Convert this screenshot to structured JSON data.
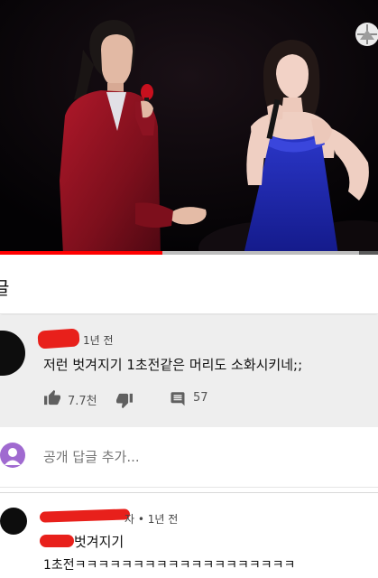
{
  "video": {
    "progress_fraction": 0.43,
    "buffered_fraction": 0.95,
    "colors": {
      "progress": "#ff0000",
      "buffer": "#bdbdbd",
      "track": "#5a5a5a"
    }
  },
  "comments": {
    "header_title": "글"
  },
  "comment1": {
    "time": "1년 전",
    "text": "저런 벗겨지기 1초전같은 머리도 소화시키네;;",
    "likes": "7.7천",
    "replies": "57"
  },
  "reply_box": {
    "placeholder": "공개 답글 추가..."
  },
  "comment2": {
    "meta": "자 • 1년 전",
    "line1": "벗겨지기",
    "line2": "1초전ㅋㅋㅋㅋㅋㅋㅋㅋㅋㅋㅋㅋㅋㅋㅋㅋㅋㅋㅋ"
  },
  "icons": [
    "thumb-up-icon",
    "thumb-down-icon",
    "reply-comment-icon",
    "channel-logo-icon"
  ]
}
